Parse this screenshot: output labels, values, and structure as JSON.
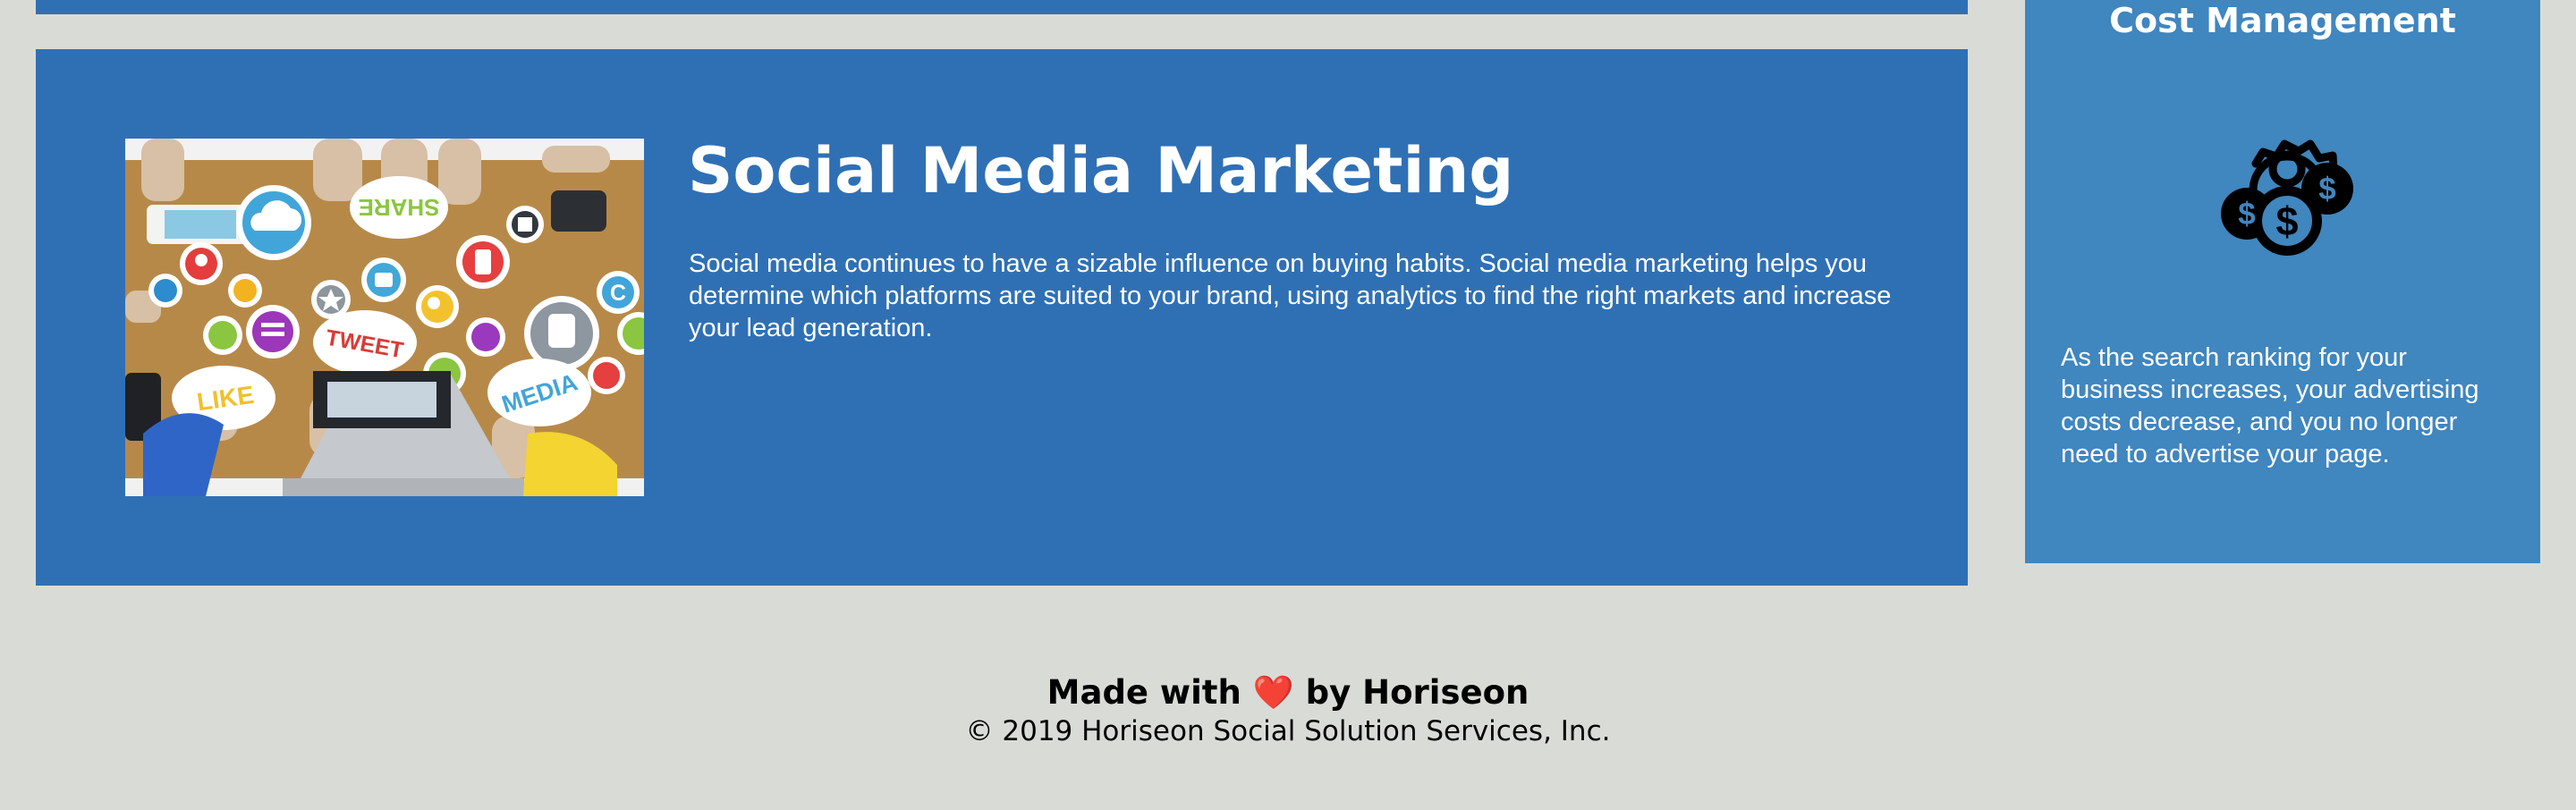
{
  "service": {
    "title": "Social Media Marketing",
    "description": "Social media continues to have a sizable influence on buying habits. Social media marketing helps you determine which platforms are suited to your brand, using analytics to find the right markets and increase your lead generation.",
    "image_icon_name": "social-media-marketing-image",
    "image_bubble_text": {
      "share": "SHARE",
      "tweet": "TWEET",
      "like": "LIKE",
      "media": "MEDIA"
    }
  },
  "benefit": {
    "title": "Cost Management",
    "icon": "cost-management-icon",
    "description": "As the search ranking for your business increases, your advertising costs decrease, and you no longer need to advertise your page."
  },
  "footer": {
    "made_before": "Made with",
    "heart": "❤️",
    "made_after": "by Horiseon",
    "copyright": "© 2019 Horiseon Social Solution Services, Inc."
  },
  "colors": {
    "page_background": "#d9dcd6",
    "service_background": "#2f70b5",
    "benefit_background": "#4086bf",
    "text_light": "#ffffff",
    "text_dark": "#000000",
    "heart": "#e0252c"
  }
}
